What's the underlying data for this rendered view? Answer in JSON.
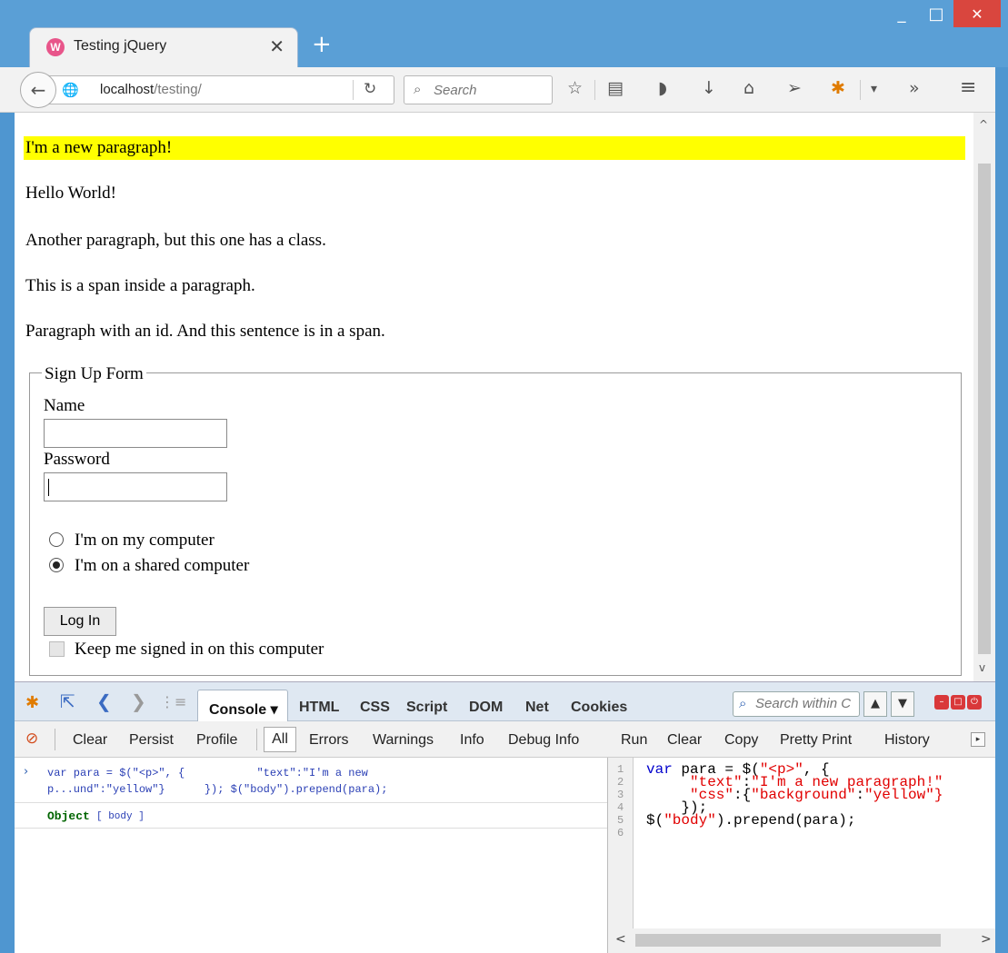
{
  "window": {
    "minimize": "_",
    "maximize": "□",
    "close": "✕"
  },
  "tab": {
    "title": "Testing jQuery",
    "favicon": "W",
    "close": "✕",
    "new_tab": "+"
  },
  "nav": {
    "url_host": "localhost",
    "url_path": "/testing/",
    "search_placeholder": "Search",
    "icons": {
      "back": "←",
      "globe": "🌐",
      "reload": "↻",
      "search": "⌕",
      "bookmark": "☆",
      "reading_list": "▤",
      "pocket": "◗",
      "download": "↓",
      "home": "⌂",
      "send": "➢",
      "firebug": "✱",
      "dropdown": "▾",
      "overflow": "»",
      "menu": "≡"
    }
  },
  "page": {
    "paragraphs": [
      "I'm a new paragraph!",
      "Hello World!",
      "Another paragraph, but this one has a class.",
      "This is a span inside a paragraph.",
      "Paragraph with an id. And this sentence is in a span."
    ],
    "form": {
      "legend": "Sign Up Form",
      "name_label": "Name",
      "name_value": "",
      "password_label": "Password",
      "password_value": "",
      "radio_options": [
        {
          "label": "I'm on my computer",
          "checked": false
        },
        {
          "label": "I'm on a shared computer",
          "checked": true
        }
      ],
      "login_button": "Log In",
      "keep_signed_label": "Keep me signed in on this computer",
      "keep_signed_checked": false
    },
    "scroll_up": "^",
    "scroll_down": "v"
  },
  "firebug": {
    "icons": {
      "logo": "✱",
      "inspect": "⇱",
      "back": "❮",
      "forward": "❯",
      "multiline": "⋮≡",
      "search": "⌕",
      "stop": "⊘",
      "run": "▸",
      "up": "▲",
      "down": "▼",
      "min": "–",
      "restore": "□",
      "close": "⏻"
    },
    "active_tab": "Console",
    "active_tab_caret": "▾",
    "tabs": [
      "HTML",
      "CSS",
      "Script",
      "DOM",
      "Net",
      "Cookies"
    ],
    "search_placeholder": "Search within C",
    "sub_left": [
      "Clear",
      "Persist",
      "Profile"
    ],
    "filter_active": "All",
    "filters": [
      "Errors",
      "Warnings",
      "Info",
      "Debug Info"
    ],
    "sub_right": [
      "Run",
      "Clear",
      "Copy",
      "Pretty Print",
      "History"
    ],
    "console_prompt": "›",
    "console_cmd_line1": "var para = $(\"<p>\", {           \"text\":\"I'm a new",
    "console_cmd_line2": "p...und\":\"yellow\"}      }); $(\"body\").prepend(para);",
    "result_label": "Object",
    "result_value": "[ body ]",
    "line_numbers": [
      "1",
      "2",
      "3",
      "4",
      "5",
      "6"
    ],
    "code": {
      "l1_kw": "var",
      "l1_rest": " para = $(",
      "l1_str": "\"<p>\"",
      "l1_end": ", {",
      "l2_str1": "\"text\"",
      "l2_colon": ":",
      "l2_str2": "\"I'm a new paragraph!\"",
      "l3_str1": "\"css\"",
      "l3_colon": ":{",
      "l3_str2": "\"background\"",
      "l3_colon2": ":",
      "l3_str3": "\"yellow\"}",
      "l4": "    });",
      "l5_pre": "$(",
      "l5_str": "\"body\"",
      "l5_end": ").prepend(para);"
    },
    "hscroll_left": "<",
    "hscroll_right": ">"
  },
  "colors": {
    "titlebar": "#5a9fd6",
    "highlight": "#ffff00",
    "firebug_toolbar": "#dfe8f2"
  }
}
